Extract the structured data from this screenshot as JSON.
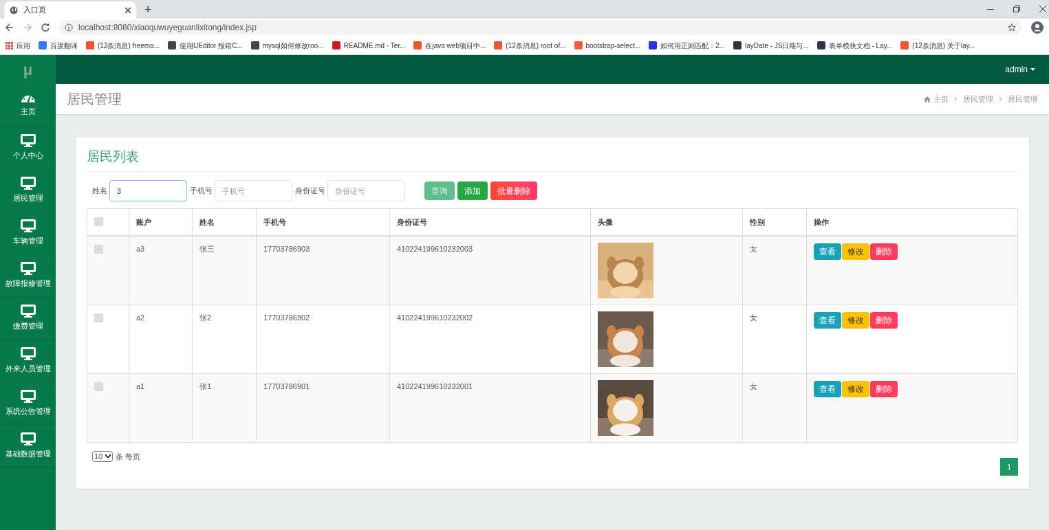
{
  "browser": {
    "tab_title": "入口页",
    "new_tab": "+",
    "url": "localhost:8080/xiaoquwuyeguanlixitong/index.jsp",
    "bookmarks": [
      {
        "label": "应用",
        "color": "#e84c3d"
      },
      {
        "label": "百度翻译",
        "color": "#2f7df6"
      },
      {
        "label": "(12条消息) freema...",
        "color": "#f2542d"
      },
      {
        "label": "使用UEditor 报错C...",
        "color": "#444444"
      },
      {
        "label": "mysql如何修改roo...",
        "color": "#444444"
      },
      {
        "label": "README.md · Ter...",
        "color": "#c71d23"
      },
      {
        "label": "在java web项目中...",
        "color": "#f2542d"
      },
      {
        "label": "(12条消息) root of...",
        "color": "#f2542d"
      },
      {
        "label": "bootstrap-select...",
        "color": "#e8603c"
      },
      {
        "label": "如何用正则匹配：2...",
        "color": "#2932e1"
      },
      {
        "label": "layDate - JS日期与...",
        "color": "#2f3542"
      },
      {
        "label": "表单模块文档 - Lay...",
        "color": "#2f3542"
      },
      {
        "label": "(12条消息) 关于lay...",
        "color": "#f2542d"
      }
    ]
  },
  "logo": "μ",
  "user": "admin",
  "sidebar": {
    "items": [
      {
        "label": "主页",
        "kind": "dashboard"
      },
      {
        "label": "个人中心",
        "kind": "module"
      },
      {
        "label": "居民管理",
        "kind": "module"
      },
      {
        "label": "车辆管理",
        "kind": "module"
      },
      {
        "label": "故障报修管理",
        "kind": "module"
      },
      {
        "label": "缴费管理",
        "kind": "module"
      },
      {
        "label": "外来人员管理",
        "kind": "module"
      },
      {
        "label": "系统公告管理",
        "kind": "module"
      },
      {
        "label": "基础数据管理",
        "kind": "module"
      }
    ]
  },
  "page_title": "居民管理",
  "breadcrumb": [
    "主页",
    "居民管理",
    "居民管理"
  ],
  "card_title": "居民列表",
  "filters": [
    {
      "label": "姓名",
      "value": "3"
    },
    {
      "label": "手机号",
      "placeholder": "手机号"
    },
    {
      "label": "身份证号",
      "placeholder": "身份证号"
    }
  ],
  "buttons": [
    {
      "label": "查询",
      "kind": "search"
    },
    {
      "label": "添加",
      "kind": "add"
    },
    {
      "label": "批量删除",
      "kind": "delete"
    }
  ],
  "table": {
    "all_checked": false,
    "columns": [
      "账户",
      "姓名",
      "手机号",
      "身份证号",
      "头像",
      "性别",
      "操作"
    ],
    "rows": [
      {
        "checked": false,
        "account": "a3",
        "name": "张三",
        "phone": "17703786903",
        "id_number": "410224199610232003",
        "gender": "女",
        "actions": [
          "查看",
          "修改",
          "删除"
        ]
      },
      {
        "checked": false,
        "account": "a2",
        "name": "张2",
        "phone": "17703786902",
        "id_number": "410224199610232002",
        "gender": "女",
        "actions": [
          "查看",
          "修改",
          "删除"
        ]
      },
      {
        "checked": false,
        "account": "a1",
        "name": "张1",
        "phone": "17703786901",
        "id_number": "410224199610232001",
        "gender": "女",
        "actions": [
          "查看",
          "修改",
          "删除"
        ]
      }
    ]
  },
  "page_size": {
    "value": "10",
    "suffix": "条 每页"
  },
  "pagination": [
    {
      "label": "1",
      "selected": true
    }
  ]
}
